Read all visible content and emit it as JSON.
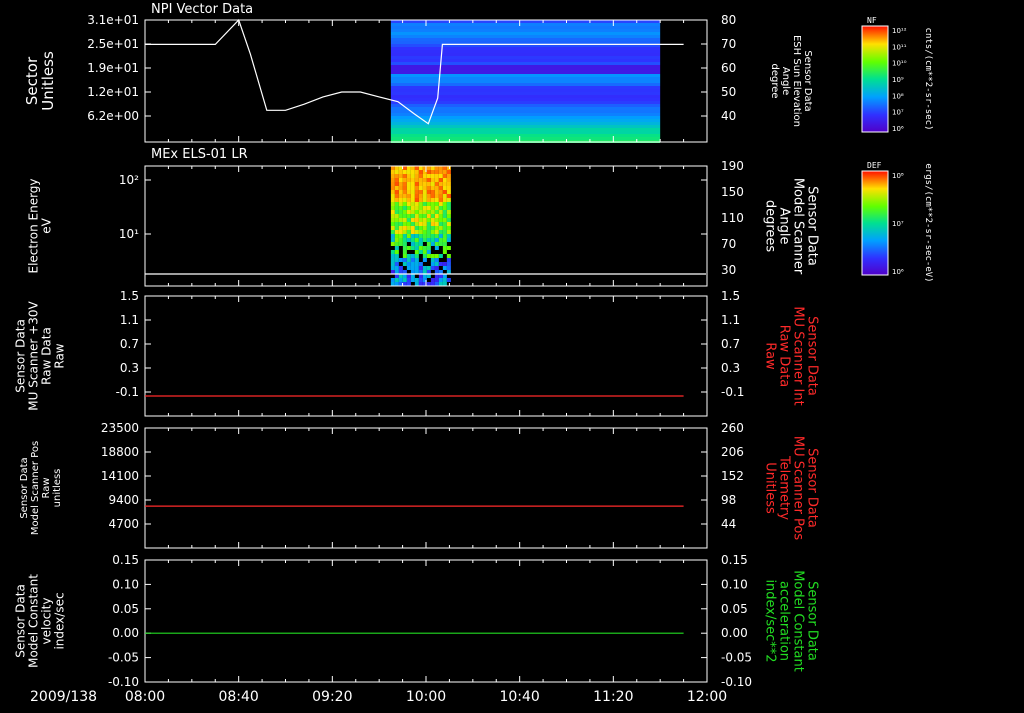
{
  "chart_data": [
    {
      "type": "line",
      "title": "NPI Vector Data",
      "ylabel": [
        "Sector",
        "Unitless"
      ],
      "yticks": [
        "3.1e+01",
        "2.5e+01",
        "1.9e+01",
        "1.2e+01",
        "6.2e+00"
      ],
      "ylabel_right": [
        "Sensor Data",
        "ESH Sun Elevation",
        "Angle",
        "degree"
      ],
      "yticks_right": [
        "80",
        "70",
        "60",
        "50",
        "40"
      ],
      "right_range": [
        30,
        80
      ],
      "spectrogram": {
        "start": "09:45",
        "end": "11:40"
      },
      "colorbar": {
        "tag": "NF",
        "ticks": [
          "10¹²",
          "10¹¹",
          "10¹⁰",
          "10⁹",
          "10⁸",
          "10⁷",
          "10⁶"
        ],
        "units": "cnts/(cm**2-sr-sec)"
      },
      "series": [
        {
          "axis": "right",
          "x": [
            "08:00",
            "08:30",
            "08:40",
            "08:45",
            "08:52",
            "09:00",
            "09:08",
            "09:16",
            "09:24",
            "09:32",
            "09:40",
            "09:48",
            "09:55",
            "10:01",
            "10:05",
            "10:07",
            "11:50"
          ],
          "values": [
            70,
            70,
            80,
            66,
            43,
            43,
            45.5,
            48.5,
            50.5,
            50.5,
            48.5,
            46.5,
            41.5,
            37.5,
            48,
            70,
            70
          ]
        }
      ]
    },
    {
      "type": "heatmap",
      "title": "MEx ELS-01 LR",
      "ylabel": [
        "Electron Energy",
        "eV"
      ],
      "yticks": [
        "10²",
        "10¹"
      ],
      "ylabel_right": [
        "Sensor Data",
        "Model Scanner",
        "Angle",
        "degrees"
      ],
      "yticks_right": [
        "190",
        "150",
        "110",
        "70",
        "30"
      ],
      "spectrogram": {
        "start": "09:45",
        "end": "10:10"
      },
      "colorbar": {
        "tag": "DEF",
        "ticks": [
          "10⁸",
          "10⁷",
          "10⁶"
        ],
        "units": "ergs/(cm**2-sr-sec-eV)"
      },
      "series": [
        {
          "axis": "right",
          "x": [
            "08:00",
            "12:00"
          ],
          "values": [
            10,
            10
          ]
        }
      ]
    },
    {
      "type": "line",
      "ylabel": [
        "Sensor Data",
        "MU Scanner +30V",
        "Raw Data",
        "Raw"
      ],
      "yticks": [
        "1.5",
        "1.1",
        "0.7",
        "0.3",
        "-0.1"
      ],
      "ylabel_right": [
        "Sensor Data",
        "MU Scanner Int",
        "Raw Data",
        "Raw"
      ],
      "yticks_right": [
        "1.5",
        "1.1",
        "0.7",
        "0.3",
        "-0.1"
      ],
      "ylim": [
        -0.3,
        1.5
      ],
      "color": "#ff2a2a",
      "series": [
        {
          "x": [
            "08:00",
            "11:50"
          ],
          "values": [
            0,
            0
          ]
        }
      ]
    },
    {
      "type": "line",
      "ylabel": [
        "Sensor Data",
        "Model Scanner Pos",
        "Raw",
        "unitless"
      ],
      "yticks": [
        "23500",
        "18800",
        "14100",
        "9400",
        "4700"
      ],
      "ylabel_right": [
        "Sensor Data",
        "MU Scanner Pos",
        "Telemetry",
        "Unitless"
      ],
      "yticks_right": [
        "260",
        "206",
        "152",
        "98",
        "44"
      ],
      "ylim": [
        0,
        23500
      ],
      "color": "#ff2a2a",
      "series": [
        {
          "x": [
            "08:00",
            "11:50"
          ],
          "values": [
            8200,
            8200
          ]
        }
      ]
    },
    {
      "type": "line",
      "ylabel": [
        "Sensor Data",
        "Model Constant",
        "velocity",
        "index/sec"
      ],
      "yticks": [
        "0.15",
        "0.10",
        "0.05",
        "0.00",
        "-0.05",
        "-0.10"
      ],
      "ylabel_right": [
        "Sensor Data",
        "Model Constant",
        "acceleration",
        "index/sec**2"
      ],
      "yticks_right": [
        "0.15",
        "0.10",
        "0.05",
        "0.00",
        "-0.05",
        "-0.10"
      ],
      "ylim": [
        -0.1,
        0.15
      ],
      "color": "#22dd22",
      "series": [
        {
          "x": [
            "08:00",
            "11:50"
          ],
          "values": [
            0,
            0
          ]
        }
      ]
    }
  ],
  "time_axis": {
    "date": "2009/138",
    "labels": [
      "08:00",
      "08:40",
      "09:20",
      "10:00",
      "10:40",
      "11:20",
      "12:00"
    ],
    "start": "08:00",
    "end": "12:00"
  }
}
